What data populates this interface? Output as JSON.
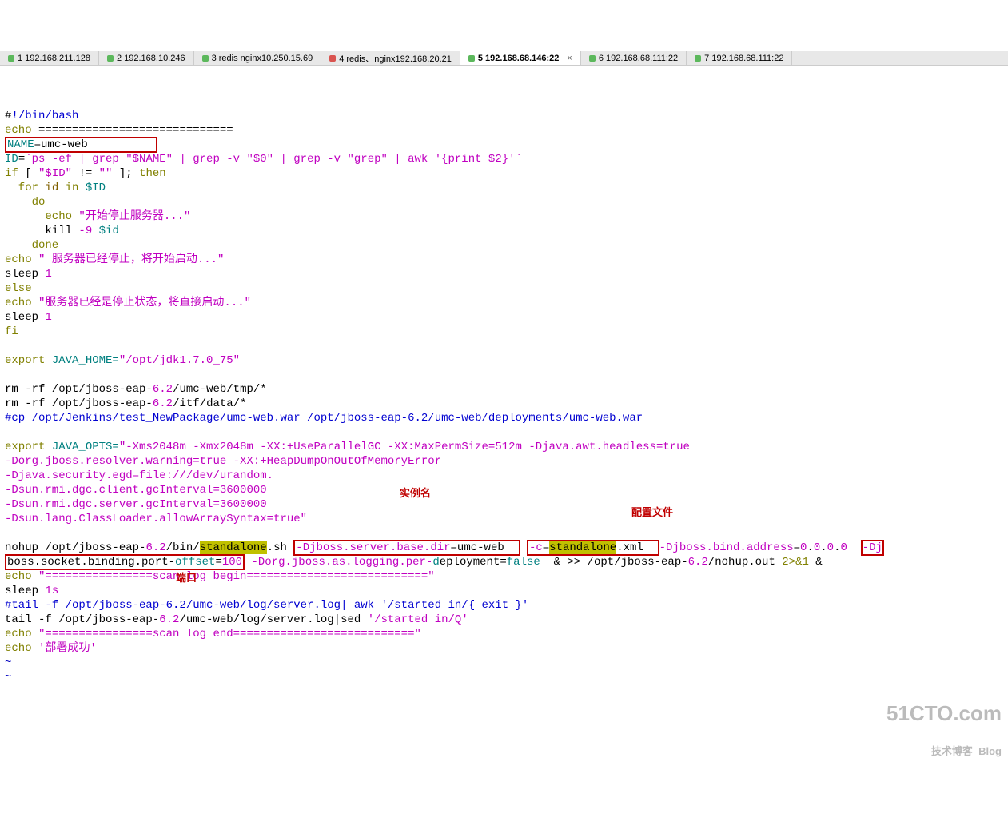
{
  "tabs": [
    {
      "label": "1 192.168.211.128",
      "dot": "green"
    },
    {
      "label": "2 192.168.10.246",
      "dot": "green"
    },
    {
      "label": "3 redis nginx10.250.15.69",
      "dot": "green"
    },
    {
      "label": "4 redis、nginx192.168.20.21",
      "dot": "red"
    },
    {
      "label": "5 192.168.68.146:22",
      "dot": "green",
      "active": true
    },
    {
      "label": "6 192.168.68.111:22",
      "dot": "green"
    },
    {
      "label": "7 192.168.68.111:22",
      "dot": "green"
    }
  ],
  "line01_a": "#",
  "line01_b": "!/bin/bash",
  "line02_a": "echo",
  "line02_b": " =============================",
  "line03_a": "NAME",
  "line03_b": "=",
  "line03_c": "umc-web",
  "line04_a": "ID",
  "line04_b": "=",
  "line04_c": "`ps -ef | grep \"$NAME\" | grep -v \"$0\" | grep -v \"grep\" | awk '{print $2}'`",
  "line05_a": "if",
  "line05_b": " [ ",
  "line05_c": "\"$ID\"",
  "line05_d": " != ",
  "line05_e": "\"\"",
  "line05_f": " ]; ",
  "line05_g": "then",
  "line06_a": "  for",
  "line06_b": " id ",
  "line06_c": "in",
  "line06_d": " $ID",
  "line07_a": "    do",
  "line08_a": "      echo",
  "line08_b": " \"开始停止服务器...\"",
  "line09_a": "      kill ",
  "line09_b": "-9",
  "line09_c": " $id",
  "line10_a": "    done",
  "line11_a": "echo",
  "line11_b": " \" 服务器已经停止，将开始启动...\"",
  "line12_a": "sleep ",
  "line12_b": "1",
  "line13_a": "else",
  "line14_a": "echo",
  "line14_b": " \"服务器已经是停止状态，将直接启动...\"",
  "line15_a": "sleep ",
  "line15_b": "1",
  "line16_a": "fi",
  "line18_a": "export",
  "line18_b": " JAVA_HOME=",
  "line18_c": "\"/opt/jdk1.7.0_75\"",
  "line20_a": "rm -rf /opt/jboss-eap-",
  "line20_b": "6.2",
  "line20_c": "/umc-web/tmp/*",
  "line21_a": "rm -rf /opt/jboss-eap-",
  "line21_b": "6.2",
  "line21_c": "/itf/data/*",
  "line22_a": "#cp /opt/Jenkins/test_NewPackage/umc-web.war /opt/jboss-eap-6.2/umc-web/deployments/umc-web.war",
  "line24_a": "export",
  "line24_b": " JAVA_OPTS=",
  "line24_c": "\"-Xms2048m -Xmx2048m -XX:+UseParallelGC -XX:MaxPermSize=512m -Djava.awt.headless=true",
  "l25": "-Dorg.jboss.resolver.warning=true -XX:+HeapDumpOnOutOfMemoryError",
  "l26": "-Djava.security.egd=file:///dev/urandom.",
  "l27": "-Dsun.rmi.dgc.client.gcInterval=3600000",
  "l28": "-Dsun.rmi.dgc.server.gcInterval=3600000",
  "l29": "-Dsun.lang.ClassLoader.allowArraySyntax=true\"",
  "line31_a": "nohup /opt/jboss-eap-",
  "line31_b": "6.2",
  "line31_c": "/bin/",
  "line31_d": "standalone",
  "line31_e": ".sh ",
  "line31_f": "-Djboss.server.base.dir",
  "line31_g": "=umc-web  ",
  "line31_h": "-c",
  "line31_i": "=",
  "line31_j": "standalone",
  "line31_k": ".xml  ",
  "line31_l": "-Djboss.bind.address",
  "line31_m": "=",
  "line31_n": "0",
  "line31_o": ".",
  "line31_p": "0",
  "line31_q": ".",
  "line31_r": "0",
  "line31_s": ".",
  "line31_t": "0",
  "line31_u": "  ",
  "line31_v": "-Dj",
  "line32_a": "boss.socket.binding.port-",
  "line32_b": "offset",
  "line32_c": "=",
  "line32_d": "100",
  "line32_e": " ",
  "line32_f": "-Dorg.jboss.as.logging.per-",
  "line32_g": "d",
  "line32_h": "eployment=",
  "line32_i": "false",
  "line32_j": "  & ",
  "line32_k": ">>",
  "line32_l": " /opt/jboss-eap-",
  "line32_m": "6.2",
  "line32_n": "/nohup.out ",
  "line32_o": "2>&1",
  "line32_p": " &",
  "line33_a": "echo",
  "line33_b": " \"================scan log begin===========================\"",
  "line34_a": "sleep ",
  "line34_b": "1s",
  "line35_a": "#tail -f /opt/jboss-eap-6.2/umc-web/log/server.log| awk '/started in/{ exit }'",
  "line36_a": "tail -f /opt/jboss-eap-",
  "line36_b": "6.2",
  "line36_c": "/umc-web/log/server.log|sed ",
  "line36_d": "'/started in/Q'",
  "line37_a": "echo",
  "line37_b": " \"================scan log end===========================\"",
  "line38_a": "echo",
  "line38_b": " '部署成功'",
  "tilde": "~",
  "anno_instance": "实例名",
  "anno_config": "配置文件",
  "anno_port": "端口",
  "watermark_big": "51CTO.com",
  "watermark_small": "技术博客  Blog"
}
